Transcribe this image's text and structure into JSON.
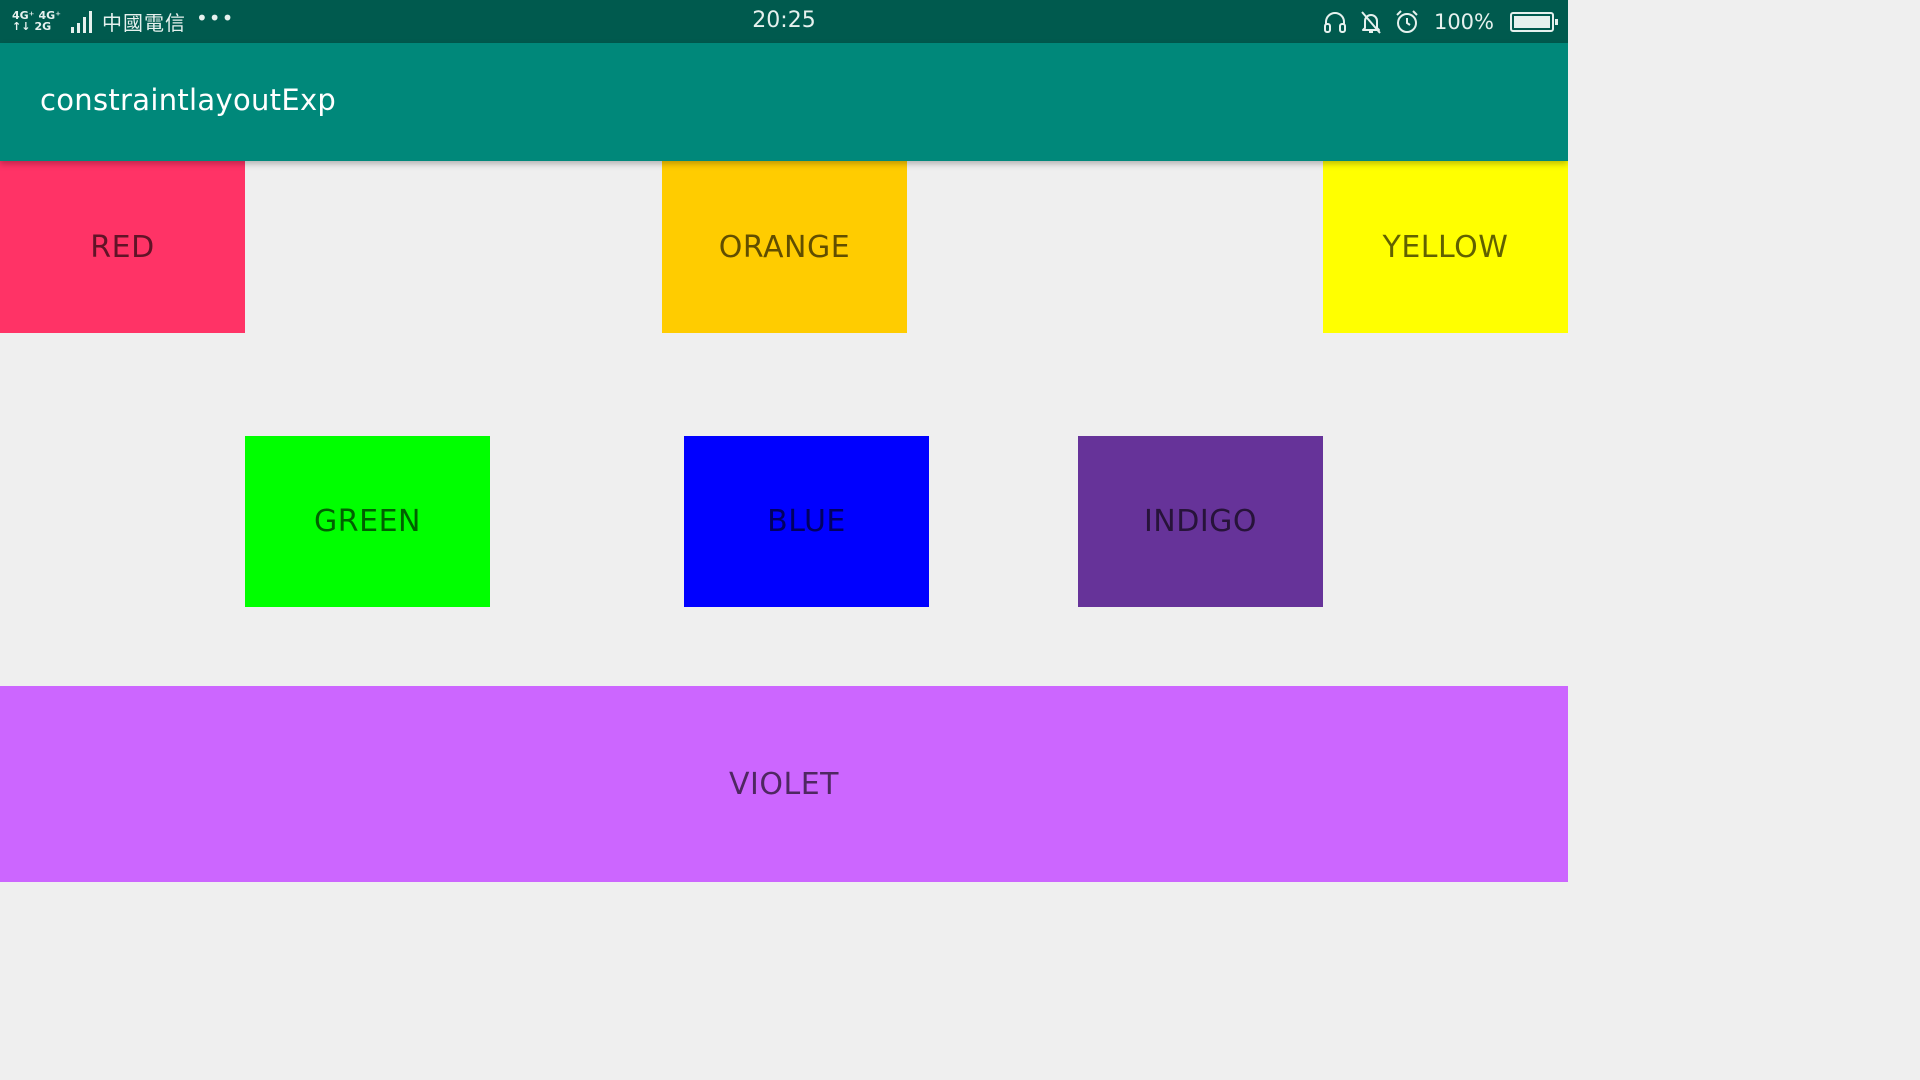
{
  "status_bar": {
    "network_top": [
      "4G⁺",
      "4G⁺"
    ],
    "network_bottom": [
      "↑↓",
      "2G"
    ],
    "carrier": "中國電信",
    "more": "•••",
    "time": "20:25",
    "battery_percent_text": "100%",
    "battery_level": 1.0,
    "icons": [
      "headphones-icon",
      "bell-off-icon",
      "alarm-clock-icon",
      "battery-icon"
    ]
  },
  "app_bar": {
    "title": "constraintlayoutExp"
  },
  "boxes": [
    {
      "id": "red",
      "label": "RED",
      "color": "#ff3366"
    },
    {
      "id": "orange",
      "label": "ORANGE",
      "color": "#ffcc00"
    },
    {
      "id": "yellow",
      "label": "YELLOW",
      "color": "#ffff00"
    },
    {
      "id": "green",
      "label": "GREEN",
      "color": "#00ff00"
    },
    {
      "id": "blue",
      "label": "BLUE",
      "color": "#0000ff"
    },
    {
      "id": "indigo",
      "label": "INDIGO",
      "color": "#663399"
    },
    {
      "id": "violet",
      "label": "VIOLET",
      "color": "#cc66ff"
    }
  ],
  "colors": {
    "status_bar_bg": "#005a4e",
    "app_bar_bg": "#00887a",
    "background": "#efefef"
  }
}
